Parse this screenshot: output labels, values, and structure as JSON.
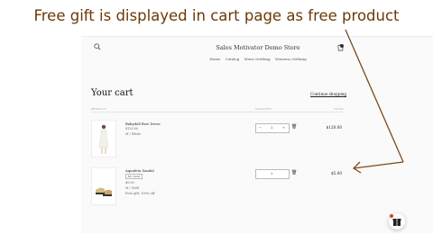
{
  "caption": "Free gift is displayed in cart page as free product",
  "store": {
    "name": "Sales Motivator Demo Store",
    "nav": [
      "Home",
      "Catalog",
      "Mens clothing",
      "Womens clothing"
    ]
  },
  "cart": {
    "title": "Your cart",
    "continue_label": "Continue shopping",
    "columns": {
      "product": "PRODUCT",
      "quantity": "QUANTITY",
      "total": "TOTAL"
    },
    "items": [
      {
        "title": "Babydoll Bow Dress",
        "price": "$120.00",
        "variant": "M / White",
        "quantity": "1",
        "total": "$120.00"
      },
      {
        "title": "Aquafeta Sandal",
        "option": "M / Gold",
        "price": "$5.00",
        "variant": "M / Gold",
        "note": "Free gift: 100% off",
        "quantity": "1",
        "total": "$5.00"
      }
    ]
  },
  "colors": {
    "caption": "#6b3a08",
    "arrow": "#7a4a1e",
    "badge": "#d0442d"
  },
  "icons": [
    "search-icon",
    "cart-icon",
    "trash-icon",
    "gift-icon"
  ]
}
